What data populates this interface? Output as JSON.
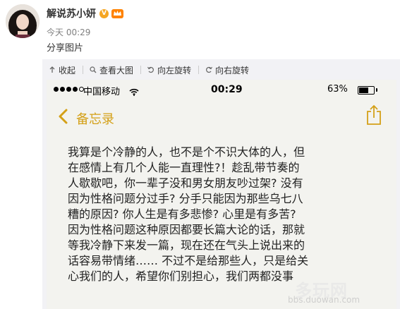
{
  "post": {
    "author": "解说苏小妍",
    "vip_badge": "V",
    "time": "今天 00:29",
    "text": "分享图片"
  },
  "toolbar": {
    "collapse": "收起",
    "view_large": "查看大图",
    "rotate_left": "向左旋转",
    "rotate_right": "向右旋转"
  },
  "phone": {
    "carrier": "中国移动",
    "time": "00:29",
    "battery": "63%",
    "battery_level": 0.63,
    "back_label": "备忘录",
    "accent_color": "#d4a017",
    "note_lines": [
      "我算是个冷静的人，也不是个不识大体的人，但",
      "在感情上有几个人能一直理性?！趁乱带节奏的",
      "人歇歇吧，你一辈子没和男女朋友吵过架? 没有",
      "因为性格问题分过手? 分手只能因为那些乌七八",
      "糟的原因? 你人生是有多悲惨? 心里是有多苦?",
      "因为性格问题这种原因都要长篇大论的话，那就",
      "等我冷静下来发一篇，现在还在气头上说出来的",
      "话容易带情绪…… 不过不是给那些人，只是给关",
      "心我们的人，希望你们别担心，我们两都没事"
    ]
  },
  "watermark": {
    "brand": "多玩网",
    "url": "bbs.duowan.com"
  }
}
